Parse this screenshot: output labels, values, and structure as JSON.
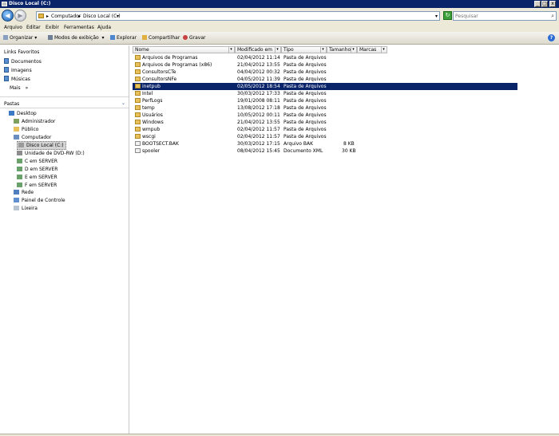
{
  "window": {
    "title": "Disco Local (C:)",
    "controls": {
      "minimize": "_",
      "maximize": "□",
      "close": "x"
    }
  },
  "address": {
    "segments": [
      "Computador",
      "Disco Local (C:)"
    ],
    "separator": "▸",
    "dropdown": "▾",
    "search_placeholder": "Pesquisar"
  },
  "menu": [
    "Arquivo",
    "Editar",
    "Exibir",
    "Ferramentas",
    "Ajuda"
  ],
  "toolbar": {
    "organize": "Organizar",
    "views": "Modos de exibição",
    "explore": "Explorar",
    "share": "Compartilhar",
    "burn": "Gravar",
    "help": "?"
  },
  "navigation": {
    "favorites_header": "Links Favoritos",
    "favorites": [
      "Documentos",
      "Imagens",
      "Músicas"
    ],
    "more": "Mais",
    "more_chevron": "»",
    "folders_header": "Pastas",
    "folders_chevron": "⌄",
    "tree": [
      "Desktop",
      "Administrador",
      "Público",
      "Computador",
      "Disco Local (C:)",
      "Unidade de DVD-RW (D:)",
      "C em SERVER",
      "D em SERVER",
      "E em SERVER",
      "F em SERVER",
      "Rede",
      "Painel de Controle",
      "Lixeira"
    ]
  },
  "columns": [
    "Nome",
    "Modificado em",
    "Tipo",
    "Tamanho",
    "Marcas"
  ],
  "files": [
    {
      "name": "Arquivos de Programas",
      "modified": "02/04/2012 11:14",
      "type": "Pasta de Arquivos",
      "size": ""
    },
    {
      "name": "Arquivos de Programas (x86)",
      "modified": "21/04/2012 13:55",
      "type": "Pasta de Arquivos",
      "size": ""
    },
    {
      "name": "ConsultorsCTe",
      "modified": "04/04/2012 00:32",
      "type": "Pasta de Arquivos",
      "size": ""
    },
    {
      "name": "ConsultorsNFe",
      "modified": "04/05/2012 11:39",
      "type": "Pasta de Arquivos",
      "size": ""
    },
    {
      "name": "inetpub",
      "modified": "02/05/2012 18:54",
      "type": "Pasta de Arquivos",
      "size": "",
      "selected": true
    },
    {
      "name": "Intel",
      "modified": "30/03/2012 17:33",
      "type": "Pasta de Arquivos",
      "size": ""
    },
    {
      "name": "PerfLogs",
      "modified": "19/01/2008 08:11",
      "type": "Pasta de Arquivos",
      "size": ""
    },
    {
      "name": "temp",
      "modified": "13/08/2012 17:18",
      "type": "Pasta de Arquivos",
      "size": ""
    },
    {
      "name": "Usuários",
      "modified": "10/05/2012 00:11",
      "type": "Pasta de Arquivos",
      "size": ""
    },
    {
      "name": "Windows",
      "modified": "21/04/2012 13:55",
      "type": "Pasta de Arquivos",
      "size": ""
    },
    {
      "name": "wmpub",
      "modified": "02/04/2012 11:57",
      "type": "Pasta de Arquivos",
      "size": ""
    },
    {
      "name": "wscgi",
      "modified": "02/04/2012 11:57",
      "type": "Pasta de Arquivos",
      "size": ""
    },
    {
      "name": "BOOTSECT.BAK",
      "modified": "30/03/2012 17:15",
      "type": "Arquivo BAK",
      "size": "8 KB"
    },
    {
      "name": "spooler",
      "modified": "08/04/2012 15:45",
      "type": "Documento XML",
      "size": "30 KB"
    }
  ],
  "colors": {
    "title_bar": "#0a246a",
    "selection": "#0a246a",
    "folder": "#e9c15c"
  }
}
